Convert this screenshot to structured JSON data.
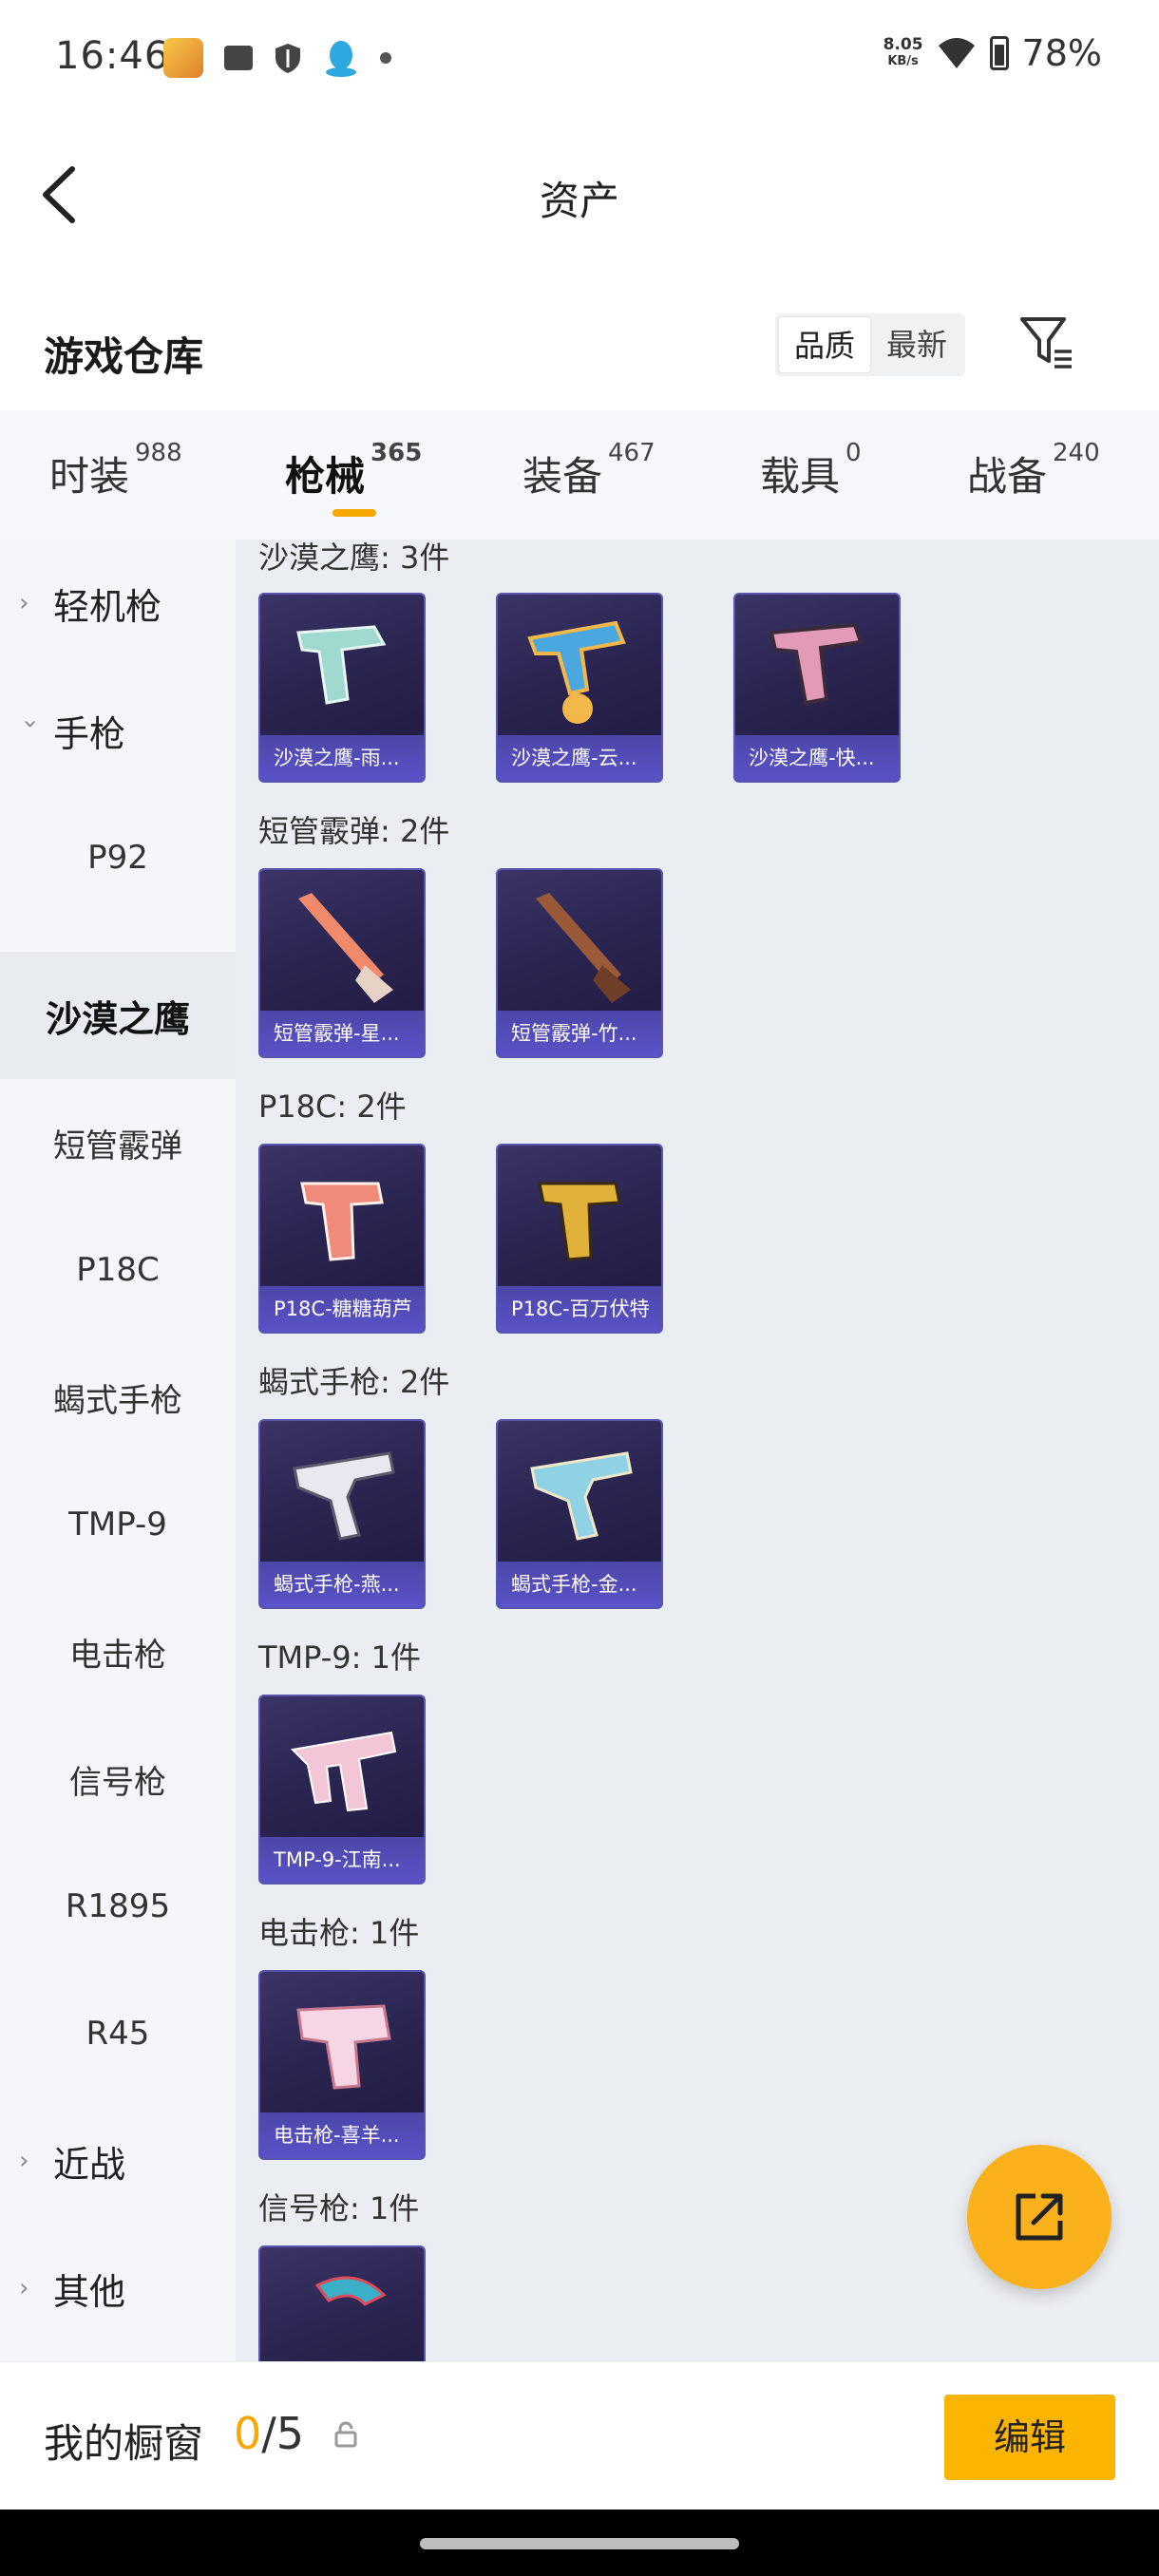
{
  "status_bar": {
    "time": "16:46",
    "speed_value": "8.05",
    "speed_unit": "KB/s",
    "battery": "78%"
  },
  "header": {
    "title": "资产"
  },
  "warehouse": {
    "title": "游戏仓库",
    "sort_quality": "品质",
    "sort_newest": "最新"
  },
  "categories": [
    {
      "label": "时装",
      "count": "988"
    },
    {
      "label": "枪械",
      "count": "365"
    },
    {
      "label": "装备",
      "count": "467"
    },
    {
      "label": "载具",
      "count": "0"
    },
    {
      "label": "战备",
      "count": "240"
    }
  ],
  "sidebar": [
    {
      "label": "轻机枪",
      "type": "group"
    },
    {
      "label": "手枪",
      "type": "group-open"
    },
    {
      "label": "P92",
      "type": "item"
    },
    {
      "label": "沙漠之鹰",
      "type": "item-active"
    },
    {
      "label": "短管霰弹",
      "type": "item"
    },
    {
      "label": "P18C",
      "type": "item"
    },
    {
      "label": "蝎式手枪",
      "type": "item"
    },
    {
      "label": "TMP-9",
      "type": "item"
    },
    {
      "label": "电击枪",
      "type": "item"
    },
    {
      "label": "信号枪",
      "type": "item"
    },
    {
      "label": "R1895",
      "type": "item"
    },
    {
      "label": "R45",
      "type": "item"
    },
    {
      "label": "近战",
      "type": "group"
    },
    {
      "label": "其他",
      "type": "group"
    }
  ],
  "sections": [
    {
      "label": "沙漠之鹰: 3件",
      "items": [
        "沙漠之鹰-雨...",
        "沙漠之鹰-云...",
        "沙漠之鹰-快..."
      ]
    },
    {
      "label": "短管霰弹: 2件",
      "items": [
        "短管霰弹-星...",
        "短管霰弹-竹..."
      ]
    },
    {
      "label": "P18C: 2件",
      "items": [
        "P18C-糖糖葫芦",
        "P18C-百万伏特"
      ]
    },
    {
      "label": "蝎式手枪: 2件",
      "items": [
        "蝎式手枪-燕...",
        "蝎式手枪-金..."
      ]
    },
    {
      "label": "TMP-9: 1件",
      "items": [
        "TMP-9-江南..."
      ]
    },
    {
      "label": "电击枪: 1件",
      "items": [
        "电击枪-喜羊..."
      ]
    },
    {
      "label": "信号枪: 1件",
      "items": [
        ""
      ]
    }
  ],
  "bottom": {
    "showcase_label": "我的橱窗",
    "showcase_current": "0",
    "showcase_total": "/5",
    "edit_label": "编辑"
  },
  "colors": {
    "accent": "#f5a800",
    "fab": "#fbb11c",
    "card_bg": "#2a2450",
    "card_label": "#5a52c8"
  }
}
